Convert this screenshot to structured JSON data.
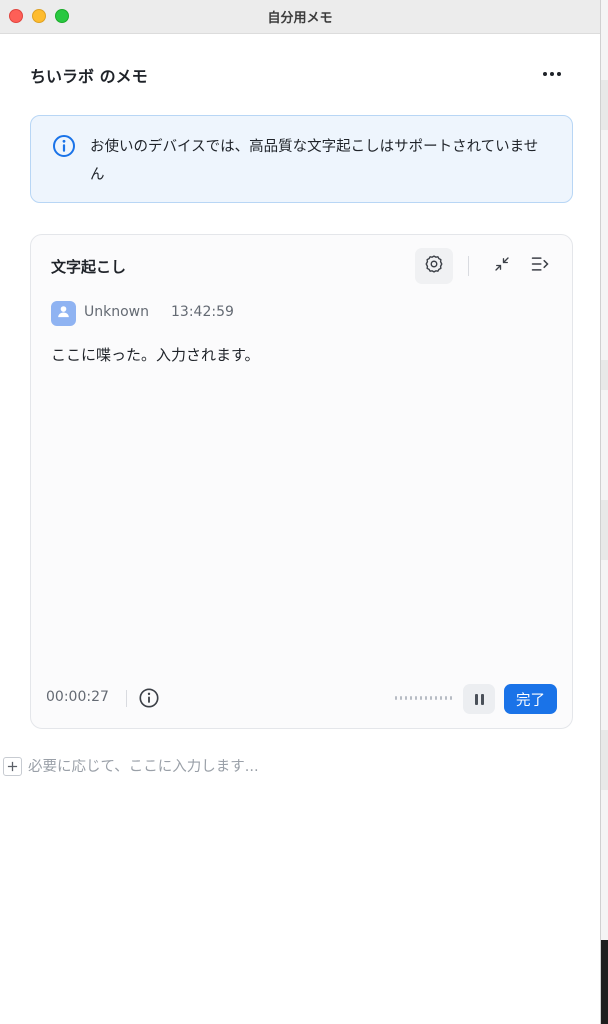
{
  "window": {
    "title": "自分用メモ"
  },
  "header": {
    "title": "ちいラボ のメモ",
    "more_icon": "more-horizontal-icon"
  },
  "notice": {
    "text": "お使いのデバイスでは、高品質な文字起こしはサポートされていません",
    "icon": "info-icon",
    "accent": "#1a73e8"
  },
  "transcription": {
    "title": "文字起こし",
    "speaker": "Unknown",
    "timestamp": "13:42:59",
    "text": "ここに喋った。入力されます。",
    "elapsed": "00:00:27",
    "done_label": "完了"
  },
  "editor": {
    "placeholder": "必要に応じて、ここに入力します..."
  },
  "colors": {
    "primary": "#1a73e8",
    "notice_bg": "#eef5fd",
    "avatar": "#8fb3f2"
  }
}
